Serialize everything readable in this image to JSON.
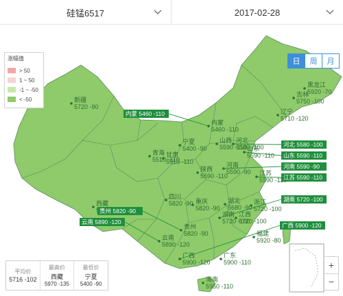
{
  "selector": {
    "product": "硅锰6517",
    "date": "2017-02-28"
  },
  "period_tabs": [
    {
      "label": "日",
      "active": true
    },
    {
      "label": "周",
      "active": false
    },
    {
      "label": "月",
      "active": false
    }
  ],
  "legend": {
    "title": "涨幅值",
    "items": [
      {
        "label": "> 50",
        "color": "#f3a7a7"
      },
      {
        "label": "1 ~ 50",
        "color": "#f6d4d4"
      },
      {
        "label": "-1 ~ -50",
        "color": "#c6e9a8"
      },
      {
        "label": "< -50",
        "color": "#8fcb6b"
      }
    ]
  },
  "colors": {
    "map_fill": "#8fcb6b",
    "border": "#5a8a5a",
    "callout_bg": "#1f8f3c",
    "label_text": "#2f6d32",
    "accent": "#3c8fd8",
    "sea": "#ffffff"
  },
  "provinces": [
    {
      "name": "新疆",
      "value": "5720 -90"
    },
    {
      "name": "西藏",
      "value": "5970 -135"
    },
    {
      "name": "青海",
      "value": "5510 -110"
    },
    {
      "name": "甘肃",
      "value": "5510 -110"
    },
    {
      "name": "宁夏",
      "value": "5400 -90"
    },
    {
      "name": "陕西",
      "value": "5590 -110"
    },
    {
      "name": "山西",
      "value": "5590 -110"
    },
    {
      "name": "内蒙",
      "value": "5460 -110"
    },
    {
      "name": "黑龙江",
      "value": "5920 -70"
    },
    {
      "name": "吉林",
      "value": "5750 -100"
    },
    {
      "name": "辽宁",
      "value": "5710 -120"
    },
    {
      "name": "河北",
      "value": "5580 -100"
    },
    {
      "name": "山东",
      "value": "5590 -110"
    },
    {
      "name": "河南",
      "value": "5590 -90"
    },
    {
      "name": "江苏",
      "value": "5590 -110"
    },
    {
      "name": "湖北",
      "value": "5680 -90"
    },
    {
      "name": "湖南",
      "value": "5720 -100"
    },
    {
      "name": "浙江",
      "value": "5720 -100"
    },
    {
      "name": "江西",
      "value": "5720 -100"
    },
    {
      "name": "四川",
      "value": "5820 -90"
    },
    {
      "name": "重庆",
      "value": "5820 -90"
    },
    {
      "name": "贵州",
      "value": "5820 -90"
    },
    {
      "name": "云南",
      "value": "5890 -120"
    },
    {
      "name": "广西",
      "value": "5900 -120"
    },
    {
      "name": "广东",
      "value": "5900 -110"
    },
    {
      "name": "福建",
      "value": "5920 -80"
    },
    {
      "name": "海南",
      "value": "5950 -110"
    }
  ],
  "callouts": [
    {
      "name": "内蒙",
      "value": "5460 -110"
    },
    {
      "name": "河北",
      "value": "5580 -100"
    },
    {
      "name": "山东",
      "value": "5590 -110"
    },
    {
      "name": "河南",
      "value": "5590 -90"
    },
    {
      "name": "江苏",
      "value": "5590 -110"
    },
    {
      "name": "湖南",
      "value": "5720 -100"
    },
    {
      "name": "贵州",
      "value": "5820 -90"
    },
    {
      "name": "云南",
      "value": "5890 -120"
    },
    {
      "name": "广西",
      "value": "5900 -120"
    }
  ],
  "stats": [
    {
      "label": "平均价",
      "main": "5716 -102",
      "sub": ""
    },
    {
      "label": "最高价",
      "main": "西藏",
      "sub": "5970 -135"
    },
    {
      "label": "最低价",
      "main": "宁夏",
      "sub": "5400 -90"
    }
  ],
  "zoom": {
    "in": "+",
    "out": "−"
  }
}
